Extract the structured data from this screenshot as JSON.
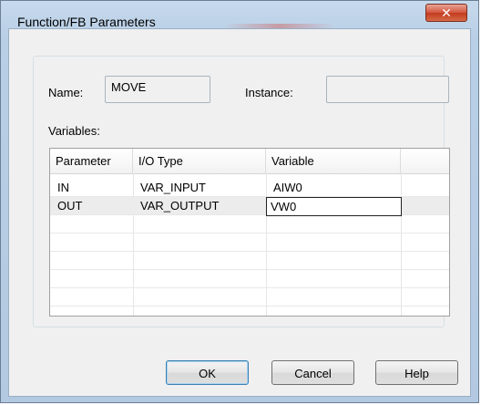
{
  "window": {
    "title": "Function/FB Parameters"
  },
  "fields": {
    "name_label": "Name:",
    "name_value": "MOVE",
    "instance_label": "Instance:",
    "instance_value": "",
    "variables_label": "Variables:"
  },
  "table": {
    "columns": [
      "Parameter",
      "I/O Type",
      "Variable"
    ],
    "rows": [
      {
        "parameter": "IN",
        "io_type": "VAR_INPUT",
        "variable": "AIW0"
      },
      {
        "parameter": "OUT",
        "io_type": "VAR_OUTPUT",
        "variable": "VW0"
      }
    ]
  },
  "buttons": {
    "ok": "OK",
    "cancel": "Cancel",
    "help": "Help"
  },
  "icons": {
    "close": "close-icon"
  }
}
